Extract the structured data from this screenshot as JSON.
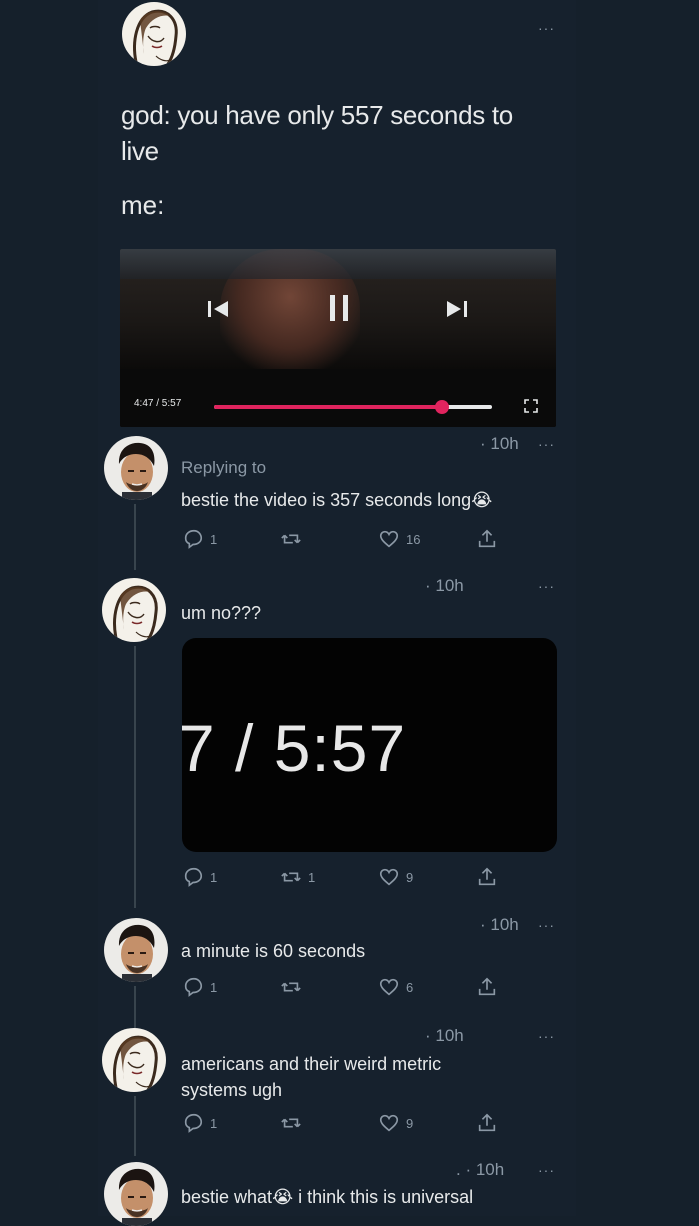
{
  "main_tweet": {
    "text_line1": "god: you have only 557 seconds to",
    "text_line2": "live",
    "text_line3": "me:",
    "more_icon": "more-dots-icon",
    "video": {
      "time_label": "4:47 / 5:57",
      "progress": 0.82,
      "prev_icon": "skip-back-icon",
      "pause_icon": "pause-icon",
      "next_icon": "skip-forward-icon",
      "fullscreen_icon": "fullscreen-icon"
    }
  },
  "replies": [
    {
      "time": "· 10h",
      "replying_to": "Replying to",
      "text": "bestie the video is 357 seconds long",
      "emoji": "😭",
      "reply_count": "1",
      "retweet_count": "",
      "like_count": "16"
    },
    {
      "time": "· 10h",
      "text": "um no???",
      "image_text": "7 / 5:57",
      "reply_count": "1",
      "retweet_count": "1",
      "like_count": "9"
    },
    {
      "time": "· 10h",
      "text": "a minute is 60 seconds",
      "reply_count": "1",
      "retweet_count": "",
      "like_count": "6"
    },
    {
      "time": "· 10h",
      "text_line1": "americans and their weird metric",
      "text_line2": "systems ugh",
      "reply_count": "1",
      "retweet_count": "",
      "like_count": "9"
    },
    {
      "time": ". · 10h",
      "text_before": "bestie what",
      "emoji": "😭",
      "text_after": " i think this is universal"
    }
  ],
  "colors": {
    "background": "#15202b",
    "progress": "#e0245e",
    "muted": "#8b98a5"
  }
}
